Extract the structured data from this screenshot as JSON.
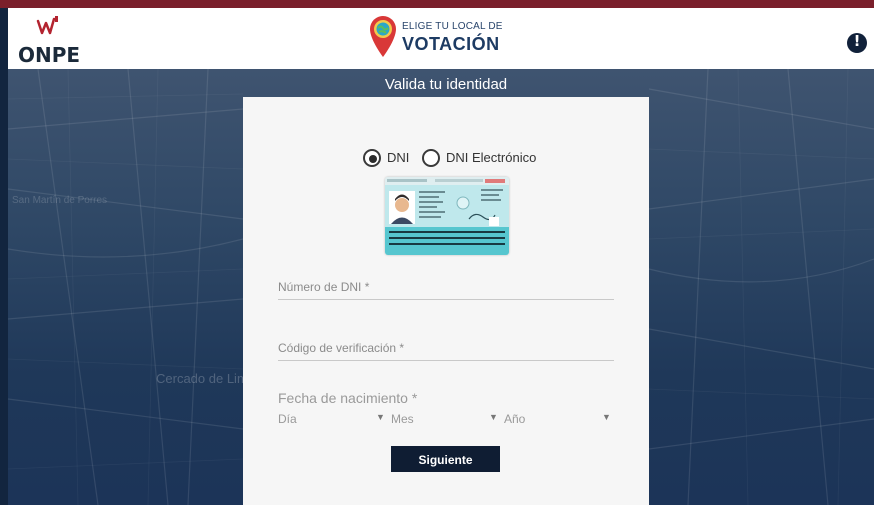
{
  "header": {
    "org_logo_text": "ONPE",
    "brand_small": "ELIGE TU LOCAL DE",
    "brand_big": "VOTACIÓN",
    "alert_glyph": "!"
  },
  "map_labels": {
    "top_left": "San Martín de Porres",
    "center": "Cercado de Lima"
  },
  "page_title": "Valida tu identidad",
  "form": {
    "doc_types": [
      {
        "label": "DNI",
        "selected": true
      },
      {
        "label": "DNI Electrónico",
        "selected": false
      }
    ],
    "dni_field": {
      "label": "Número de DNI *",
      "value": ""
    },
    "verification_field": {
      "label": "Código de verificación *",
      "value": ""
    },
    "dob_label": "Fecha de nacimiento *",
    "dob_selects": [
      {
        "placeholder": "Día",
        "value": ""
      },
      {
        "placeholder": "Mes",
        "value": ""
      },
      {
        "placeholder": "Año",
        "value": ""
      }
    ],
    "submit_label": "Siguiente"
  },
  "colors": {
    "header_bg": "#ffffff",
    "top_strip": "#7a1f2b",
    "map_bg": "#1f3859",
    "card_bg": "#f6f6f6",
    "button_bg": "#0f1d33",
    "dni_card_accent": "#4fc3c9"
  },
  "icons": {
    "alert": "exclamation-circle-icon",
    "brand": "map-pin-icon",
    "radio_selected": "radio-selected-icon",
    "radio_unselected": "radio-unselected-icon",
    "select_arrow": "caret-down-icon"
  }
}
